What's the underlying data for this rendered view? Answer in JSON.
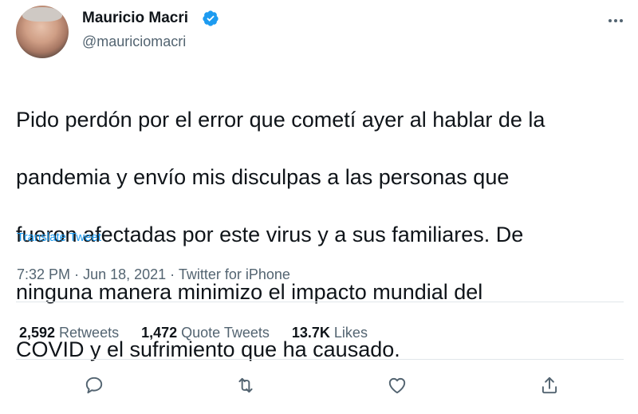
{
  "author": {
    "name": "Mauricio Macri",
    "handle": "@mauriciomacri",
    "verified": true
  },
  "tweet": {
    "text_lines": [
      "Pido perdón por el error que cometí ayer al hablar de la",
      "pandemia y envío mis disculpas a las personas que",
      "fueron afectadas por este virus y a sus familiares. De",
      "ninguna manera minimizo el impacto mundial del",
      "COVID y el sufrimiento que ha causado."
    ],
    "translate_label": "Translate Tweet",
    "time": "7:32 PM",
    "date": "Jun 18, 2021",
    "source": "Twitter for iPhone",
    "separator": "·"
  },
  "stats": {
    "retweets_count": "2,592",
    "retweets_label": "Retweets",
    "quotes_count": "1,472",
    "quotes_label": "Quote Tweets",
    "likes_count": "13.7K",
    "likes_label": "Likes"
  },
  "actions": {
    "icons": [
      "reply-icon",
      "retweet-icon",
      "like-icon",
      "share-icon"
    ],
    "icon_color": "#536471",
    "verified_color": "#1d9bf0"
  }
}
